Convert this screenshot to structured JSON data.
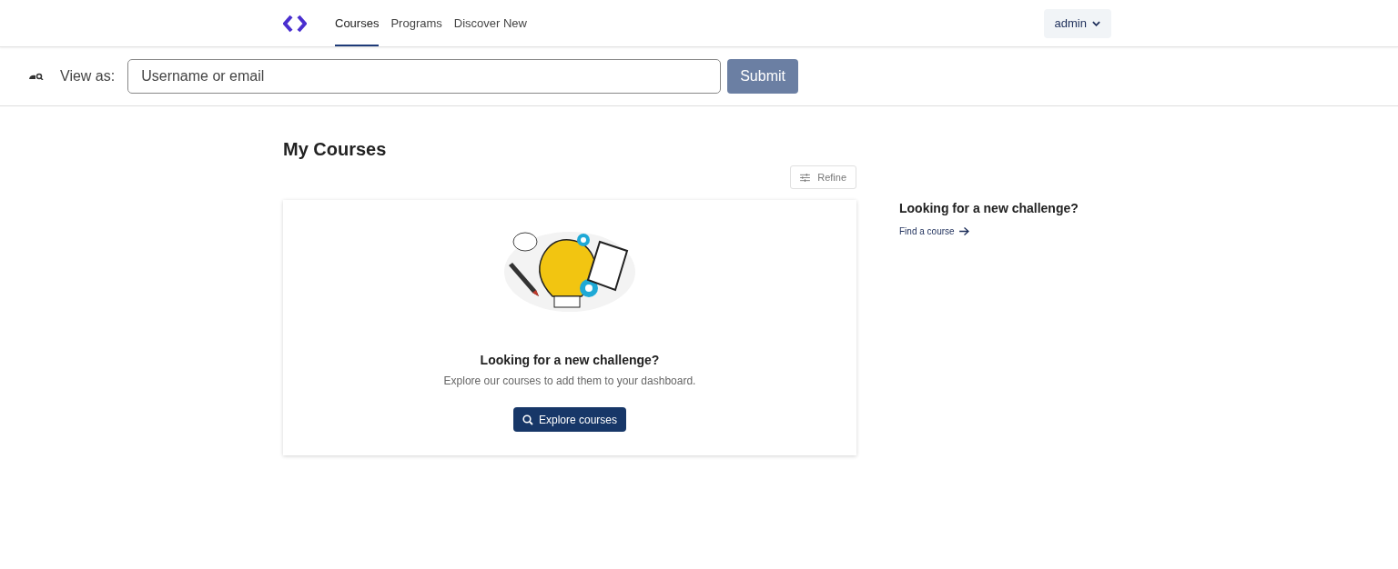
{
  "header": {
    "nav": [
      {
        "label": "Courses",
        "selected": true
      },
      {
        "label": "Programs",
        "selected": false
      },
      {
        "label": "Discover New",
        "selected": false
      }
    ],
    "user_menu": "admin"
  },
  "masquerade": {
    "label": "View as:",
    "placeholder": "Username or email",
    "submit": "Submit"
  },
  "main": {
    "title": "My Courses",
    "refine": "Refine",
    "empty_state": {
      "title": "Looking for a new challenge?",
      "text": "Explore our courses to add them to your dashboard.",
      "button": "Explore courses"
    }
  },
  "sidebar": {
    "title": "Looking for a new challenge?",
    "link": "Find a course"
  }
}
